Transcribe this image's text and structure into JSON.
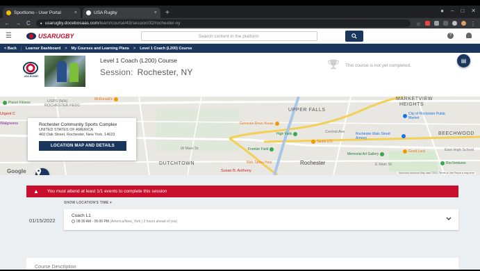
{
  "browser": {
    "tabs": [
      {
        "title": "Sportlomo - User Portal",
        "favicon_color": "#fbbc04",
        "active": false
      },
      {
        "title": "USA Rugby",
        "favicon_color": "#1b365d",
        "active": true
      }
    ],
    "new_tab_symbol": "+",
    "close_symbol": "×",
    "window_controls": [
      "●",
      "–",
      "□",
      "✕"
    ],
    "nav": {
      "back": "←",
      "forward": "→",
      "reload": "C"
    },
    "url_host": "usarugby.docebosaas.com",
    "url_path": "/learn/course/43/session/32/rochester-ny",
    "lock": "🔒"
  },
  "site": {
    "logo_text": "USARUGBY",
    "search_placeholder": "Search content in the platform",
    "search_icon": "🔍",
    "help_icon": "?",
    "bell_icon": "🔔",
    "menu_icon": "☰"
  },
  "breadcrumb": {
    "back": "< Back",
    "items": [
      "Learner Dashboard",
      "My Courses and Learning Plans",
      "Level 1 Coach (L200) Course"
    ],
    "separator": ">"
  },
  "course": {
    "logo_label": "USA RUGBY",
    "title": "Level 1 Coach (L200) Course",
    "session_label": "Session:",
    "session_name": "Rochester, NY",
    "status": "This course is not yet completed.",
    "trophy_icon": "🏆",
    "fab_icon": "▤"
  },
  "map": {
    "labels": {
      "planet_fitness": "Planet Fitness",
      "usps": "USPS (N/A)",
      "usps2": "ROCHESTER PEDC",
      "mcdonalds": "McDonald's",
      "urgent": "Urgent C",
      "walgreens": "Walgreens",
      "upper_falls": "UPPER FALLS",
      "marketview": "MARKETVIEW",
      "heights": "HEIGHTS",
      "city_market": "City of Rochester Public Market",
      "genesee": "Genesee Brew House",
      "high_falls": "High Falls",
      "central_ave": "Central Ave",
      "main_armory": "Rochester Main Street Armory",
      "taco": "Tacos 172",
      "beechwood": "BEECHWOOD",
      "frontier": "Frontier Field",
      "memorial": "Memorial Art Gallery",
      "good_luck": "Good Luck",
      "east_high": "East High School",
      "dutchtown": "DUTCHTOWN",
      "nick": "Nick Tahou Hots",
      "rochester": "Rochester",
      "susan": "Susan B. Anthony",
      "roc": "RocVentures",
      "google": "Google",
      "footer": "Keyboard shortcuts   Map data ©2021   Terms of Use   Report a map error",
      "main_st": "E Main St",
      "w_main": "W Main St"
    },
    "infobox": {
      "name": "Rochester Community Sports Complex",
      "country": "UNITED STATES OF AMERICA",
      "address": "460 Oak Street, Rochester, New York, 14623",
      "button": "LOCATION MAP AND DETAILS"
    },
    "pin_icon": "⬤"
  },
  "session": {
    "alert_icon": "▲",
    "alert": "You must attend at least 1/1 events to complete this session",
    "show_time": "SHOW LOCATION'S TIME ▾",
    "events": [
      {
        "date": "01/15/2022",
        "name": "Coach L1",
        "clock_icon": "🕒",
        "time": "08:30 AM - 05:00 PM",
        "tz": "(America/New_York | 2 hours ahead of you)",
        "chevron": "⌄"
      }
    ],
    "description_heading": "Course Description"
  },
  "colors": {
    "navy": "#1b365d",
    "red": "#c8102e"
  }
}
